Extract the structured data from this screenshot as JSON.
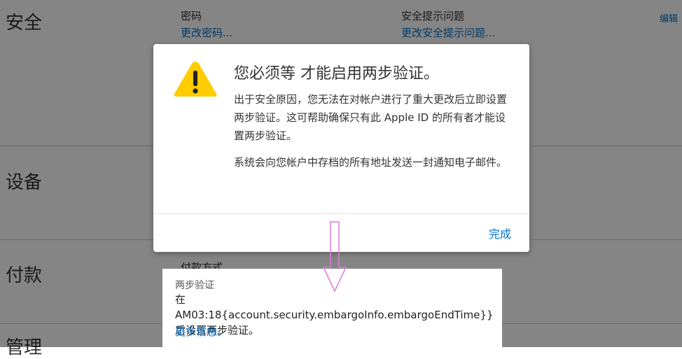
{
  "sections": {
    "security": {
      "title": "安全",
      "password_label": "密码",
      "password_link": "更改密码...",
      "question_label": "安全提示问题",
      "question_link": "更改安全提示问题...",
      "edit_label": "编辑"
    },
    "devices": {
      "title": "设备"
    },
    "payment": {
      "title": "付款",
      "method_label": "付款方式"
    },
    "fourth": {
      "title": "管理"
    }
  },
  "dialog": {
    "title": "您必须等 才能启用两步验证。",
    "paragraph1": "出于安全原因，您无法在对帐户进行了重大更改后立即设置两步验证。这可帮助确保只有此 Apple ID 的所有者才能设置两步验证。",
    "paragraph2": "系统会向您帐户中存档的所有地址发送一封通知电子邮件。",
    "done_label": "完成",
    "icon": "warning-icon",
    "icon_color": "#ffcc00"
  },
  "two_step_panel": {
    "label": "两步验证",
    "text": "在AM03:18{account.security.embargoInfo.embargoEndTime}}后设置两步验证。",
    "more_link": "更多信息。"
  },
  "annotation": {
    "arrow_color": "#e07ad8"
  }
}
